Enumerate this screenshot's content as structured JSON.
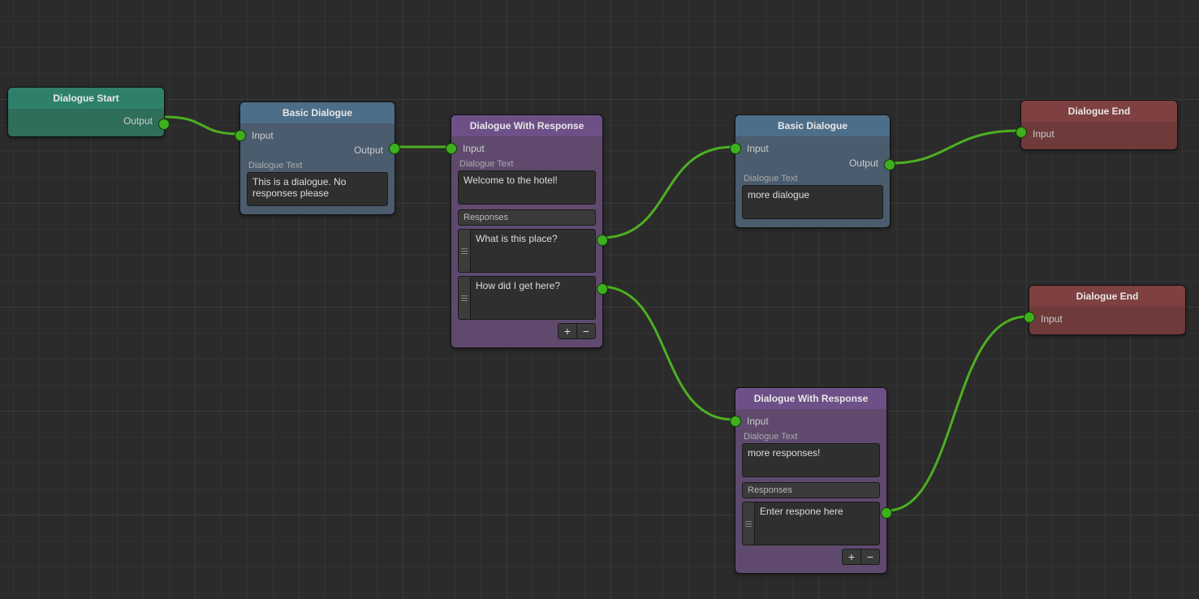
{
  "labels": {
    "input": "Input",
    "output": "Output",
    "dialogue_text": "Dialogue Text",
    "responses": "Responses",
    "plus": "+",
    "minus": "−"
  },
  "nodes": {
    "start": {
      "title": "Dialogue Start"
    },
    "basic1": {
      "title": "Basic Dialogue",
      "dialogue_text": "This is a dialogue. No responses please"
    },
    "resp1": {
      "title": "Dialogue With Response",
      "dialogue_text": "Welcome to the hotel!",
      "responses": [
        "What is this place?",
        "How did I get here?"
      ]
    },
    "basic2": {
      "title": "Basic Dialogue",
      "dialogue_text": "more dialogue"
    },
    "resp2": {
      "title": "Dialogue With Response",
      "dialogue_text": "more responses!",
      "responses": [
        "Enter respone here"
      ]
    },
    "end1": {
      "title": "Dialogue End"
    },
    "end2": {
      "title": "Dialogue End"
    }
  },
  "edges": [
    {
      "from": "start.output",
      "to": "basic1.input"
    },
    {
      "from": "basic1.output",
      "to": "resp1.input"
    },
    {
      "from": "resp1.responses.0",
      "to": "basic2.input"
    },
    {
      "from": "resp1.responses.1",
      "to": "resp2.input"
    },
    {
      "from": "basic2.output",
      "to": "end1.input"
    },
    {
      "from": "resp2.responses.0",
      "to": "end2.input"
    }
  ],
  "colors": {
    "edge": "#4caf22",
    "port": "#3fae1f",
    "start": "#2e806a",
    "basic": "#4d6e88",
    "response": "#6e5088",
    "end": "#7e4040"
  }
}
